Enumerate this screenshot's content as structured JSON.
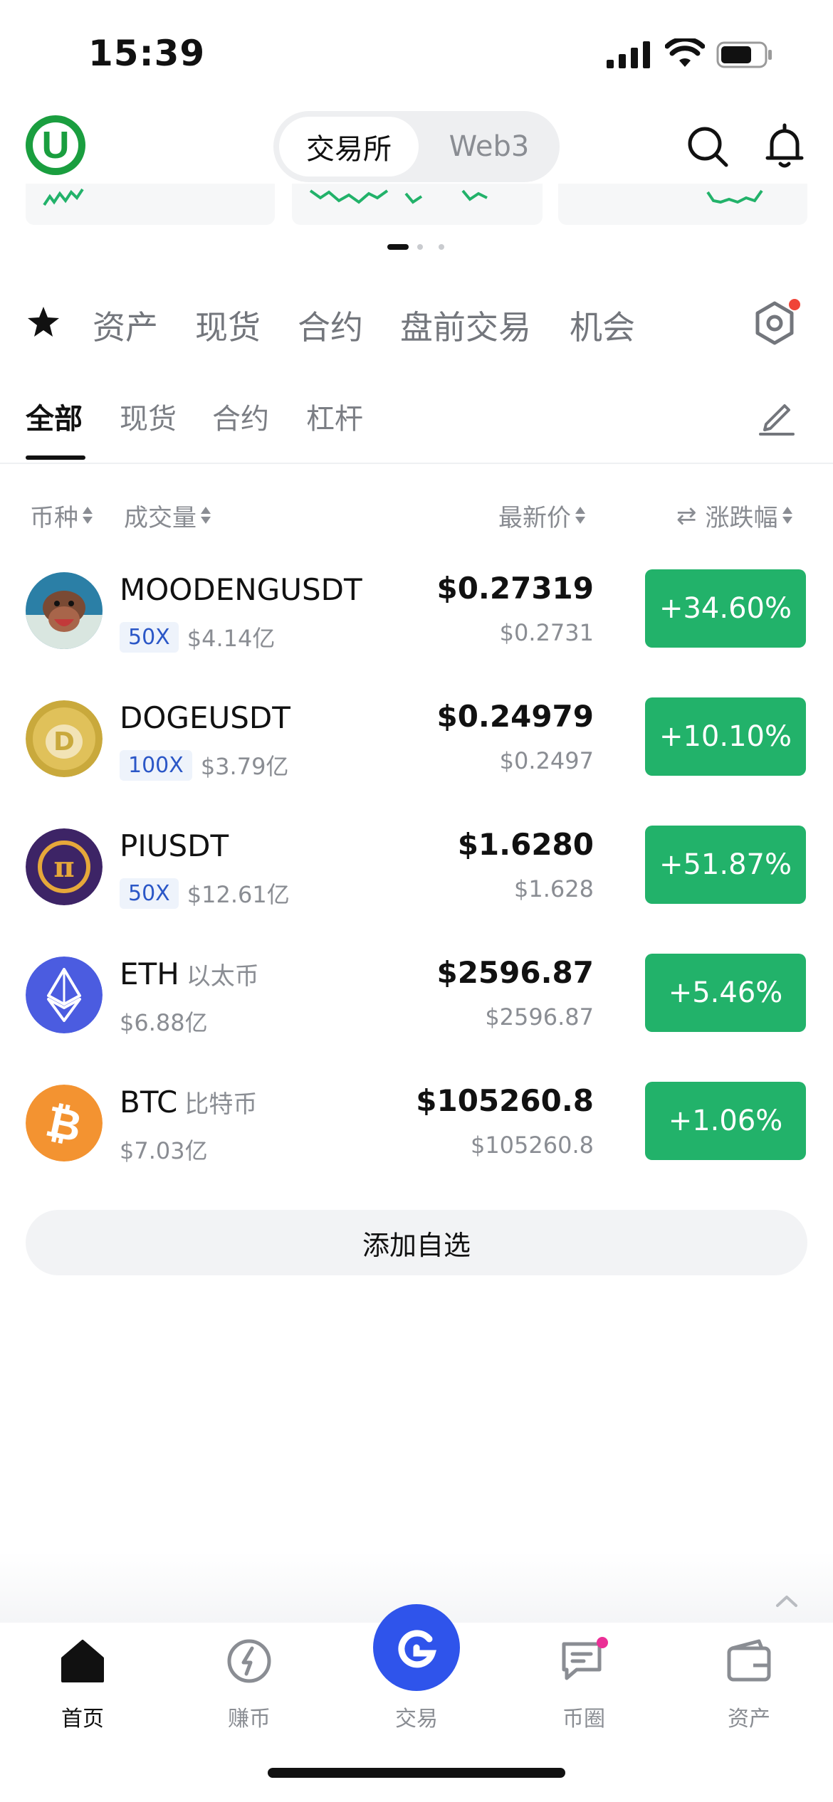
{
  "status_bar": {
    "time": "15:39"
  },
  "header": {
    "logo_letter": "U",
    "segments": [
      "交易所",
      "Web3"
    ],
    "active_segment": "交易所"
  },
  "category_tabs": [
    "资产",
    "现货",
    "合约",
    "盘前交易",
    "机会"
  ],
  "sub_tabs": [
    "全部",
    "现货",
    "合约",
    "杠杆"
  ],
  "active_sub_tab": "全部",
  "columns": {
    "coin": "币种",
    "volume": "成交量",
    "price": "最新价",
    "change": "涨跌幅"
  },
  "rows": [
    {
      "symbol": "MOODENGUSDT",
      "name_cn": "",
      "leverage": "50X",
      "volume": "$4.14亿",
      "price": "$0.27319",
      "price_sub": "$0.2731",
      "change": "+34.60%"
    },
    {
      "symbol": "DOGEUSDT",
      "name_cn": "",
      "leverage": "100X",
      "volume": "$3.79亿",
      "price": "$0.24979",
      "price_sub": "$0.2497",
      "change": "+10.10%"
    },
    {
      "symbol": "PIUSDT",
      "name_cn": "",
      "leverage": "50X",
      "volume": "$12.61亿",
      "price": "$1.6280",
      "price_sub": "$1.628",
      "change": "+51.87%"
    },
    {
      "symbol": "ETH",
      "name_cn": "以太币",
      "leverage": "",
      "volume": "$6.88亿",
      "price": "$2596.87",
      "price_sub": "$2596.87",
      "change": "+5.46%"
    },
    {
      "symbol": "BTC",
      "name_cn": "比特币",
      "leverage": "",
      "volume": "$7.03亿",
      "price": "$105260.8",
      "price_sub": "$105260.8",
      "change": "+1.06%"
    }
  ],
  "add_button": "添加自选",
  "bottom_nav": [
    {
      "label": "首页",
      "icon": "home-icon",
      "active": true
    },
    {
      "label": "赚币",
      "icon": "earn-icon",
      "active": false
    },
    {
      "label": "交易",
      "icon": "trade-icon",
      "active": false
    },
    {
      "label": "币圈",
      "icon": "community-icon",
      "active": false
    },
    {
      "label": "资产",
      "icon": "wallet-icon",
      "active": false
    }
  ],
  "colors": {
    "brand_green": "#1a9e3f",
    "up_green": "#22b26a",
    "trade_blue": "#2f54eb",
    "badge_red": "#f04438",
    "badge_pink": "#eb2f96"
  }
}
